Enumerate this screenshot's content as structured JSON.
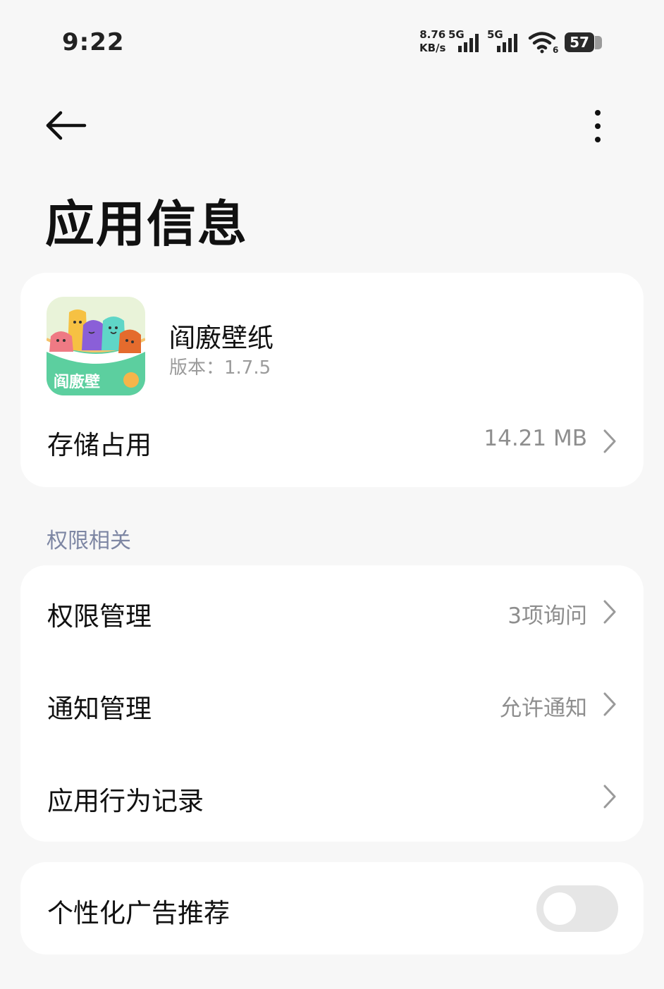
{
  "status_bar": {
    "time": "9:22",
    "net_speed_value": "8.76",
    "net_speed_unit": "KB/s",
    "sim1_label": "5G",
    "sim2_label": "5G",
    "wifi_label": "6",
    "battery": "57"
  },
  "header": {
    "back_icon": "arrow-left-icon",
    "more_icon": "more-vertical-icon",
    "title": "应用信息"
  },
  "app": {
    "name": "阎廒壁纸",
    "version": "版本：1.7.5",
    "icon_text": "阎廒壁"
  },
  "storage": {
    "label": "存储占用",
    "value": "14.21 MB"
  },
  "permissions_section": {
    "header": "权限相关",
    "items": [
      {
        "label": "权限管理",
        "value": "3项询问"
      },
      {
        "label": "通知管理",
        "value": "允许通知"
      },
      {
        "label": "应用行为记录",
        "value": ""
      }
    ]
  },
  "ads": {
    "label": "个性化广告推荐",
    "enabled": false
  },
  "colors": {
    "background": "#f7f7f7",
    "card": "#ffffff",
    "section_header": "#7d86a3",
    "secondary_text": "#8e8e8e",
    "toggle_off": "#e6e6e6"
  }
}
